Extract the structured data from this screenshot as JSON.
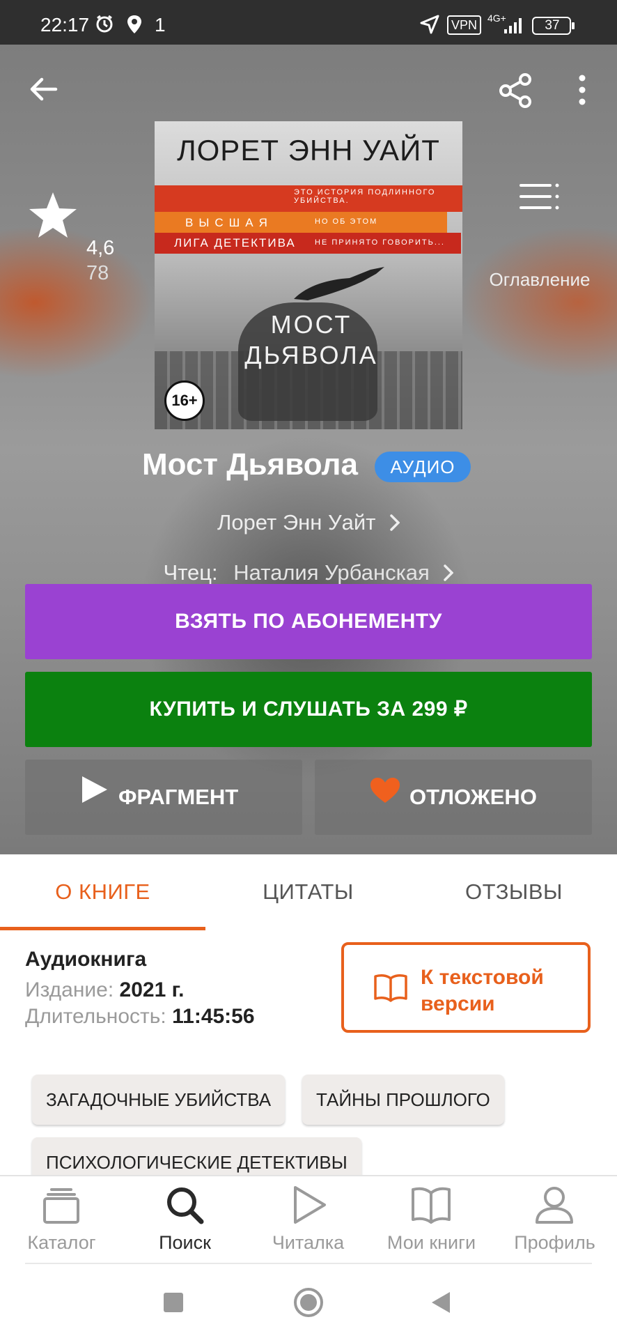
{
  "status_bar": {
    "time": "22:17",
    "notification_count": "1",
    "vpn": "VPN",
    "network": "4G+",
    "battery": "37",
    "icons": [
      "alarm-icon",
      "location-pin-icon",
      "navigation-arrow-icon",
      "signal-icon",
      "battery-icon"
    ]
  },
  "header": {
    "icons": [
      "back-arrow-icon",
      "share-icon",
      "more-vert-icon"
    ]
  },
  "cover": {
    "author_line": "ЛОРЕТ ЭНН УАЙТ",
    "series_line1": "ВЫСШАЯ",
    "series_line2": "ЛИГА ДЕТЕКТИВА",
    "tagline1": "ЭТО ИСТОРИЯ ПОДЛИННОГО УБИЙСТВА.",
    "tagline2": "НО ОБ ЭТОМ",
    "tagline3": "НЕ ПРИНЯТО ГОВОРИТЬ...",
    "title_line1": "МОСТ",
    "title_line2": "ДЬЯВОЛА",
    "age_rating": "16+"
  },
  "rating": {
    "value": "4,6",
    "count": "78"
  },
  "toc": {
    "label": "Оглавление"
  },
  "book": {
    "title": "Мост Дьявола",
    "badge": "АУДИО",
    "author": "Лорет Энн Уайт",
    "reader_label": "Чтец:",
    "reader": "Наталия Урбанская"
  },
  "buttons": {
    "subscription": "ВЗЯТЬ ПО АБОНЕМЕНТУ",
    "buy": "КУПИТЬ И СЛУШАТЬ ЗА  299 ₽",
    "fragment": "ФРАГМЕНТ",
    "saved": "ОТЛОЖЕНО"
  },
  "tabs": [
    {
      "label": "О КНИГЕ",
      "active": true
    },
    {
      "label": "ЦИТАТЫ",
      "active": false
    },
    {
      "label": "ОТЗЫВЫ",
      "active": false
    }
  ],
  "info": {
    "type": "Аудиокнига",
    "edition_label": "Издание:",
    "edition_value": "2021 г.",
    "duration_label": "Длительность:",
    "duration_value": "11:45:56"
  },
  "text_version": {
    "label": "К текстовой версии"
  },
  "tags": [
    "ЗАГАДОЧНЫЕ УБИЙСТВА",
    "ТАЙНЫ ПРОШЛОГО",
    "ПСИХОЛОГИЧЕСКИЕ ДЕТЕКТИВЫ"
  ],
  "bottom_nav": [
    {
      "label": "Каталог",
      "icon": "catalog-icon",
      "active": false
    },
    {
      "label": "Поиск",
      "icon": "search-icon",
      "active": true
    },
    {
      "label": "Читалка",
      "icon": "play-icon",
      "active": false
    },
    {
      "label": "Мои книги",
      "icon": "book-icon",
      "active": false
    },
    {
      "label": "Профиль",
      "icon": "profile-icon",
      "active": false
    }
  ],
  "colors": {
    "accent": "#e8601c",
    "subscription": "#9a42d2",
    "buy": "#0b810f",
    "badge": "#3d8ee6",
    "heart": "#f0601e"
  }
}
